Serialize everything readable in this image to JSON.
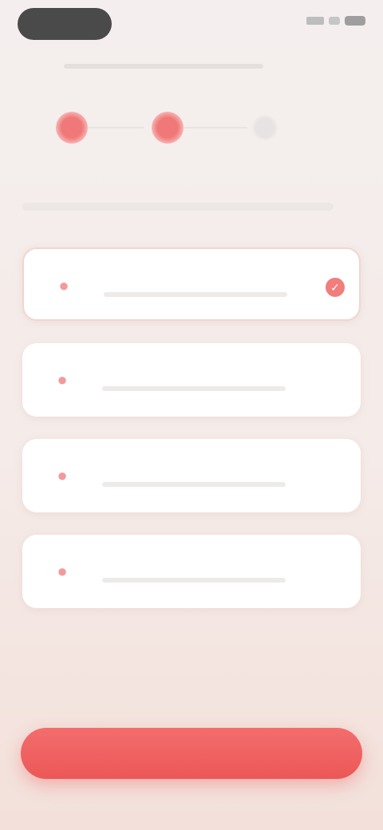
{
  "header": {
    "title": ""
  },
  "question": {
    "text": ""
  },
  "options": [
    {
      "label": "",
      "icon": "option-icon",
      "selected": true
    },
    {
      "label": "",
      "icon": "option-icon",
      "selected": false
    },
    {
      "label": "",
      "icon": "option-icon",
      "selected": false
    },
    {
      "label": "",
      "icon": "option-icon",
      "selected": false
    }
  ],
  "stepper": {
    "current": 2,
    "total": 3
  },
  "cta": {
    "label": ""
  },
  "colors": {
    "accent": "#f06666",
    "accent_light": "#f7c6c6",
    "card": "#ffffff"
  }
}
